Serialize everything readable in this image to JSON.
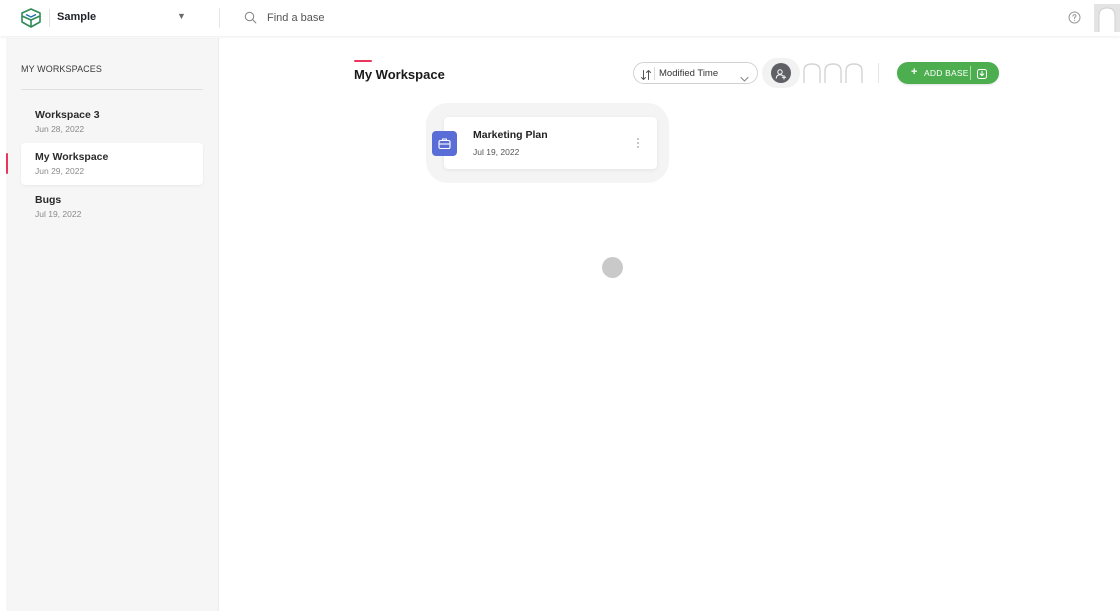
{
  "topbar": {
    "project_name": "Sample",
    "search": {
      "placeholder": "Find a base",
      "value": ""
    },
    "icons": {
      "logo": "app-logo-icon",
      "caret": "caret-down-icon",
      "search": "search-icon",
      "help": "help-icon",
      "avatar": "user-avatar-icon"
    }
  },
  "sidebar": {
    "title": "MY WORKSPACES",
    "workspaces": [
      {
        "name": "Workspace 3",
        "date": "Jun 28, 2022",
        "active": false
      },
      {
        "name": "My Workspace",
        "date": "Jun 29, 2022",
        "active": true
      },
      {
        "name": "Bugs",
        "date": "Jul 19, 2022",
        "active": false
      }
    ]
  },
  "main": {
    "title": "My Workspace",
    "sort": {
      "selected": "Modified Time",
      "icon": "sort-icon"
    },
    "invite_icon": "add-user-icon",
    "add_base_label": "ADD BASE",
    "import_icon": "import-icon",
    "bases": [
      {
        "name": "Marketing Plan",
        "date": "Jul 19, 2022",
        "icon": "briefcase-icon"
      }
    ]
  },
  "colors": {
    "accent": "#e8365d",
    "primary_green": "#4cae4f",
    "base_icon": "#5a6cd6",
    "sidebar_bg": "#f6f6f6"
  }
}
